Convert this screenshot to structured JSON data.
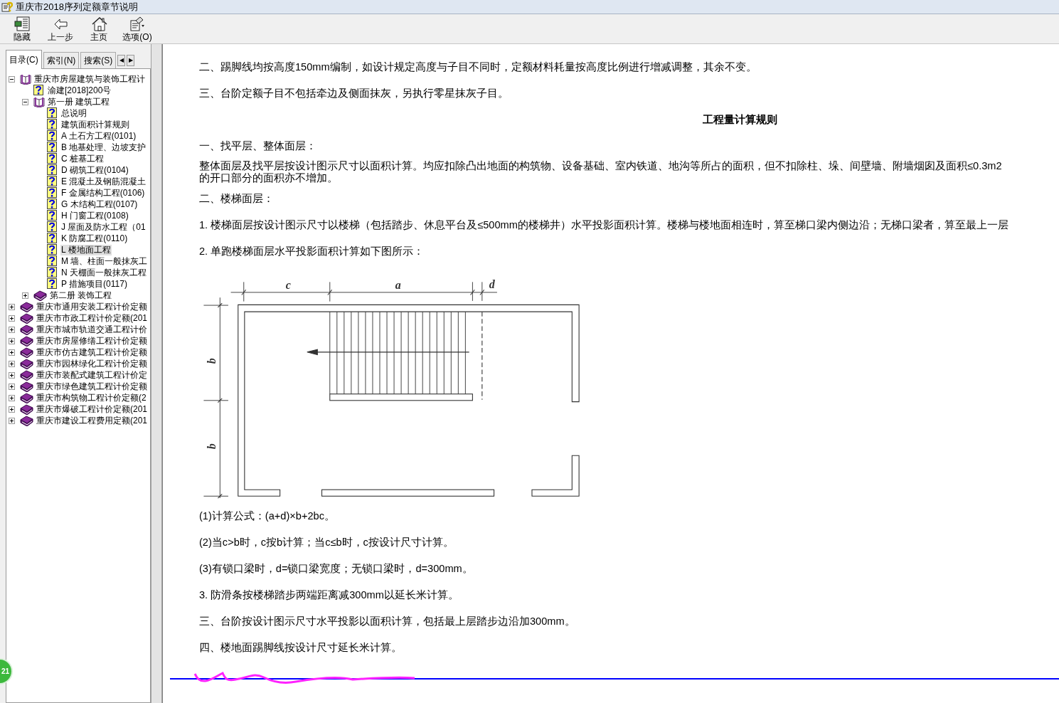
{
  "window": {
    "title": "重庆市2018序列定额章节说明"
  },
  "toolbar": [
    {
      "label": "隐藏",
      "kind": "hide"
    },
    {
      "label": "上一步",
      "kind": "back"
    },
    {
      "label": "主页",
      "kind": "home"
    },
    {
      "label": "选项(O)",
      "kind": "options"
    }
  ],
  "tabs": [
    {
      "label": "目录(C)",
      "selected": true
    },
    {
      "label": "索引(N)",
      "selected": false
    },
    {
      "label": "搜索(S)",
      "selected": false
    }
  ],
  "tab_scroll": [
    "◀",
    "▶"
  ],
  "tree": [
    {
      "label": "重庆市房屋建筑与装饰工程计",
      "kind": "volume",
      "expanded": true,
      "selected": false,
      "children": [
        {
          "label": "渝建[2018]200号",
          "kind": "page",
          "selected": false
        },
        {
          "label": "第一册 建筑工程",
          "kind": "volume",
          "expanded": true,
          "selected": false,
          "children": [
            {
              "label": "总说明",
              "kind": "page",
              "selected": false
            },
            {
              "label": "建筑面积计算规则",
              "kind": "page",
              "selected": false
            },
            {
              "label": "A 土石方工程(0101)",
              "kind": "page",
              "selected": false
            },
            {
              "label": "B 地基处理、边坡支护",
              "kind": "page",
              "selected": false
            },
            {
              "label": "C 桩基工程",
              "kind": "page",
              "selected": false
            },
            {
              "label": "D 砌筑工程(0104)",
              "kind": "page",
              "selected": false
            },
            {
              "label": "E 混凝土及钢筋混凝土",
              "kind": "page",
              "selected": false
            },
            {
              "label": "F 金属结构工程(0106)",
              "kind": "page",
              "selected": false
            },
            {
              "label": "G 木结构工程(0107)",
              "kind": "page",
              "selected": false
            },
            {
              "label": "H 门窗工程(0108)",
              "kind": "page",
              "selected": false
            },
            {
              "label": "J 屋面及防水工程（01",
              "kind": "page",
              "selected": false
            },
            {
              "label": "K 防腐工程(0110)",
              "kind": "page",
              "selected": false
            },
            {
              "label": "L 楼地面工程",
              "kind": "page",
              "selected": true
            },
            {
              "label": "M 墙、柱面一般抹灰工",
              "kind": "page",
              "selected": false
            },
            {
              "label": "N 天棚面一般抹灰工程",
              "kind": "page",
              "selected": false
            },
            {
              "label": "P 措施项目(0117)",
              "kind": "page",
              "selected": false
            }
          ]
        },
        {
          "label": "第二册 装饰工程",
          "kind": "book",
          "expanded": false,
          "selected": false
        }
      ]
    },
    {
      "label": "重庆市通用安装工程计价定额",
      "kind": "book",
      "expanded": false,
      "selected": false
    },
    {
      "label": "重庆市市政工程计价定额(201",
      "kind": "book",
      "expanded": false,
      "selected": false
    },
    {
      "label": "重庆市城市轨道交通工程计价",
      "kind": "book",
      "expanded": false,
      "selected": false
    },
    {
      "label": "重庆市房屋修缮工程计价定额",
      "kind": "book",
      "expanded": false,
      "selected": false
    },
    {
      "label": "重庆市仿古建筑工程计价定额",
      "kind": "book",
      "expanded": false,
      "selected": false
    },
    {
      "label": "重庆市园林绿化工程计价定额",
      "kind": "book",
      "expanded": false,
      "selected": false
    },
    {
      "label": "重庆市装配式建筑工程计价定",
      "kind": "book",
      "expanded": false,
      "selected": false
    },
    {
      "label": "重庆市绿色建筑工程计价定额",
      "kind": "book",
      "expanded": false,
      "selected": false
    },
    {
      "label": "重庆市构筑物工程计价定额(2",
      "kind": "book",
      "expanded": false,
      "selected": false
    },
    {
      "label": "重庆市爆破工程计价定额(201",
      "kind": "book",
      "expanded": false,
      "selected": false
    },
    {
      "label": "重庆市建设工程费用定额(201",
      "kind": "book",
      "expanded": false,
      "selected": false
    }
  ],
  "content": [
    {
      "kind": "text",
      "lines": [
        "二、踢脚线均按高度150mm编制，如设计规定高度与子目不同时，定额材料耗量按高度比例进行增减调整，其余不变。"
      ]
    },
    {
      "kind": "text",
      "lines": [
        "三、台阶定额子目不包括牵边及侧面抹灰，另执行零星抹灰子目。"
      ]
    },
    {
      "kind": "heading",
      "lines": [
        "工程量计算规则"
      ]
    },
    {
      "kind": "text",
      "lines": [
        "一、找平层、整体面层："
      ]
    },
    {
      "kind": "text",
      "lines": [
        "整体面层及找平层按设计图示尺寸以面积计算。均应扣除凸出地面的构筑物、设备基础、室内铁道、地沟等所占的面积，但不扣除柱、垛、间壁墙、附墙烟囱及面积≤0.3m2",
        "的开口部分的面积亦不增加。"
      ]
    },
    {
      "kind": "text",
      "lines": [
        "二、楼梯面层："
      ]
    },
    {
      "kind": "text",
      "lines": [
        "1. 楼梯面层按设计图示尺寸以楼梯（包括踏步、休息平台及≤500mm的楼梯井）水平投影面积计算。楼梯与楼地面相连时，算至梯口梁内侧边沿；无梯口梁者，算至最上一层"
      ]
    },
    {
      "kind": "text",
      "lines": [
        "2. 单跑楼梯面层水平投影面积计算如下图所示："
      ]
    },
    {
      "kind": "figure",
      "labels": [
        "c",
        "a",
        "d",
        "b",
        "b"
      ]
    },
    {
      "kind": "text",
      "lines": [
        "(1)计算公式：(a+d)×b+2bc。"
      ]
    },
    {
      "kind": "text",
      "lines": [
        "(2)当c>b时，c按b计算；当c≤b时，c按设计尺寸计算。"
      ]
    },
    {
      "kind": "text",
      "lines": [
        "(3)有锁口梁时，d=锁口梁宽度；无锁口梁时，d=300mm。"
      ]
    },
    {
      "kind": "text",
      "lines": [
        "3. 防滑条按楼梯踏步两端距离减300mm以延长米计算。"
      ]
    },
    {
      "kind": "text",
      "lines": [
        "三、台阶按设计图示尺寸水平投影以面积计算，包括最上层踏步边沿加300mm。"
      ]
    },
    {
      "kind": "text",
      "lines": [
        "四、楼地面踢脚线按设计尺寸延长米计算。"
      ]
    }
  ],
  "badge": {
    "text": "21"
  }
}
